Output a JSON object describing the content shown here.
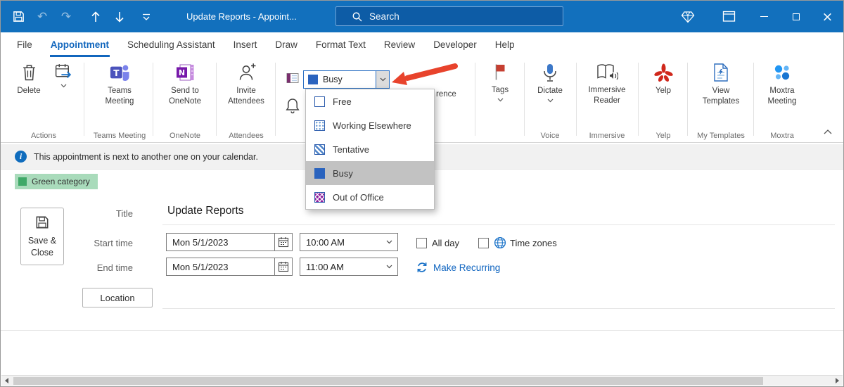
{
  "titlebar": {
    "title": "Update Reports  -  Appoint...",
    "search_placeholder": "Search",
    "undo_glyph": "↶",
    "redo_glyph": "↷",
    "close_glyph": "×"
  },
  "tabs": {
    "items": [
      "File",
      "Appointment",
      "Scheduling Assistant",
      "Insert",
      "Draw",
      "Format Text",
      "Review",
      "Developer",
      "Help"
    ],
    "active": "Appointment"
  },
  "ribbon": {
    "delete_label": "Delete",
    "actions_group": "Actions",
    "teams_label": "Teams Meeting",
    "teams_group": "Teams Meeting",
    "onenote_label": "Send to OneNote",
    "onenote_group": "OneNote",
    "attendees_label": "Invite Attendees",
    "attendees_group": "Attendees",
    "show_as_value": "Busy",
    "partial_label": "rence",
    "tags_label": "Tags",
    "dictate_label": "Dictate",
    "voice_group": "Voice",
    "immersive_label": "Immersive Reader",
    "immersive_group": "Immersive",
    "yelp_label": "Yelp",
    "yelp_group": "Yelp",
    "templates_label": "View Templates",
    "templates_group": "My Templates",
    "moxtra_label": "Moxtra Meeting",
    "moxtra_group": "Moxtra"
  },
  "show_as_dropdown": {
    "selected": "Busy",
    "options": [
      {
        "label": "Free",
        "pattern": "free"
      },
      {
        "label": "Working Elsewhere",
        "pattern": "dots"
      },
      {
        "label": "Tentative",
        "pattern": "stripes"
      },
      {
        "label": "Busy",
        "pattern": "solid"
      },
      {
        "label": "Out of Office",
        "pattern": "crosshatch"
      }
    ]
  },
  "infobar": {
    "message": "This appointment is next to another one on your calendar."
  },
  "category": {
    "label": "Green category"
  },
  "form": {
    "save_close_label": "Save & Close",
    "title_label": "Title",
    "title_value": "Update Reports",
    "start_label": "Start time",
    "start_date": "Mon 5/1/2023",
    "start_time": "10:00 AM",
    "end_label": "End time",
    "end_date": "Mon 5/1/2023",
    "end_time": "11:00 AM",
    "all_day_label": "All day",
    "time_zones_label": "Time zones",
    "make_recurring_label": "Make Recurring",
    "location_label": "Location"
  },
  "colors": {
    "titlebar_blue": "#1270bd",
    "accent_blue": "#1166bd",
    "busy_blue": "#2a63be",
    "out_of_office_purple": "#8e1d9e",
    "category_green": "#3fa968",
    "category_green_bg": "#a9dbbb",
    "yelp_red": "#d0281c",
    "annotation_arrow_red": "#e8432c"
  }
}
